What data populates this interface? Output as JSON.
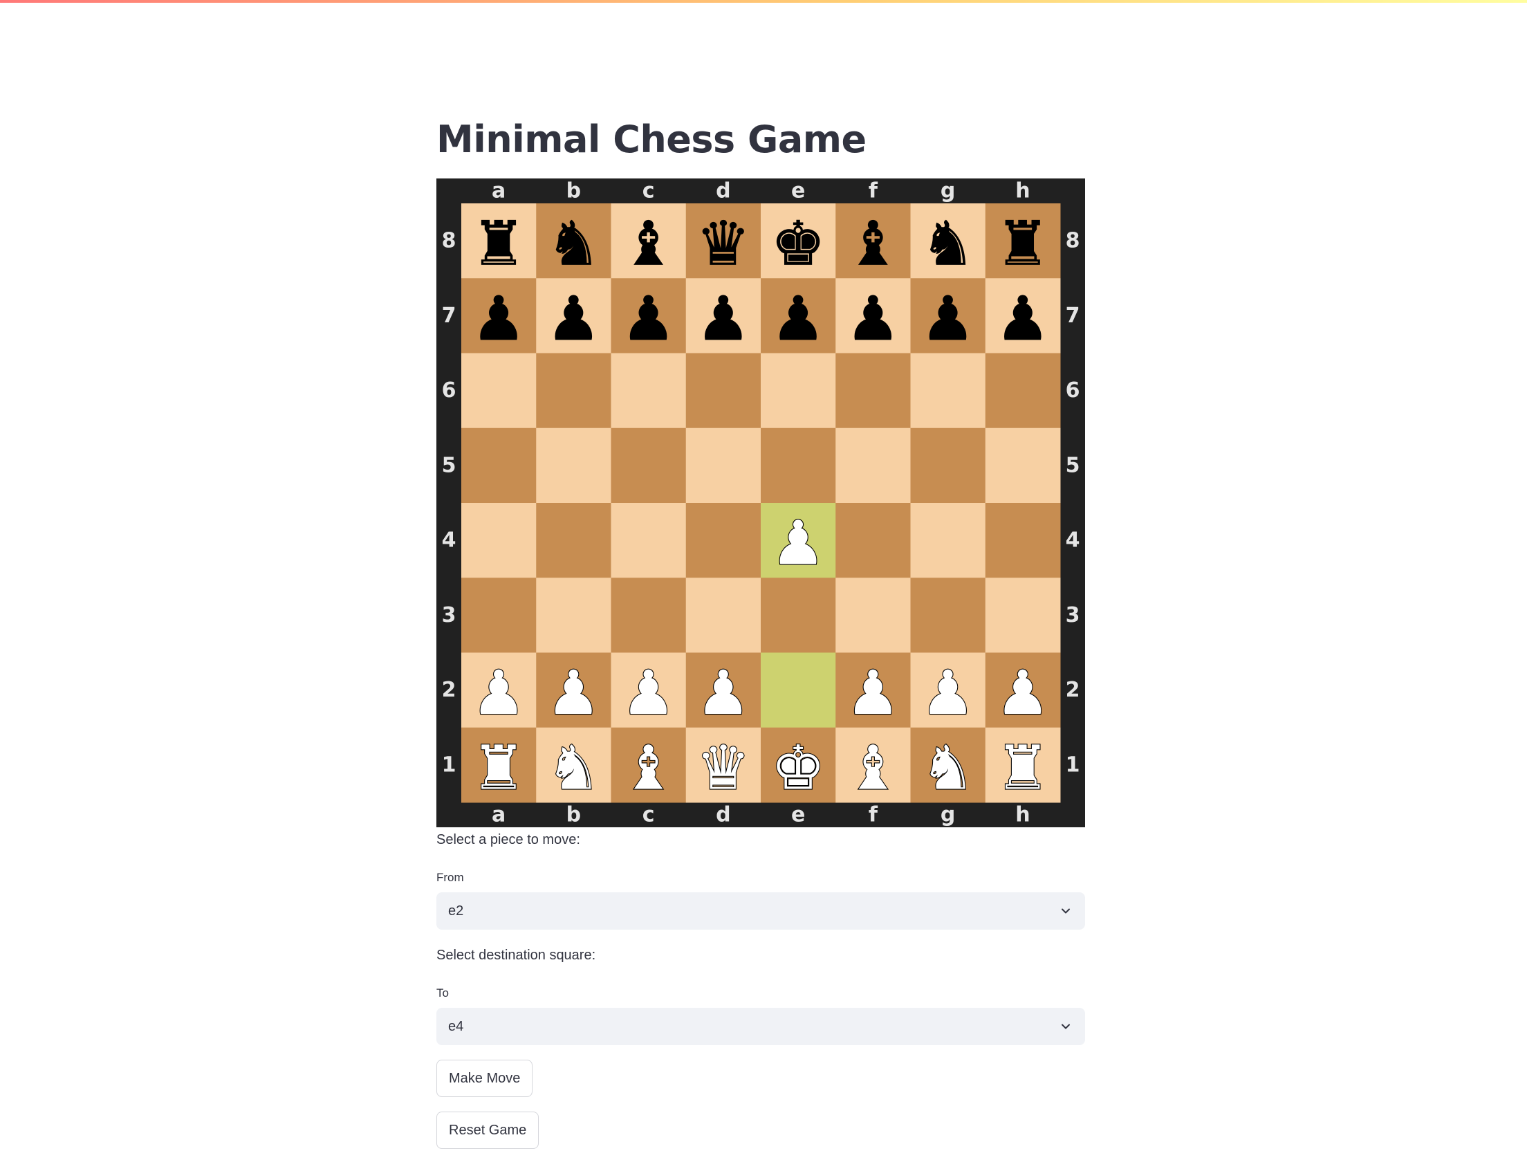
{
  "page": {
    "title": "Minimal Chess Game"
  },
  "board": {
    "files": [
      "a",
      "b",
      "c",
      "d",
      "e",
      "f",
      "g",
      "h"
    ],
    "ranks": [
      "8",
      "7",
      "6",
      "5",
      "4",
      "3",
      "2",
      "1"
    ],
    "colors": {
      "light": "#f7d0a3",
      "dark": "#c78d51",
      "highlight_light": "#cdd26f",
      "highlight_dark": "#aaa23a",
      "frame": "#212121",
      "coordinates": "#e5e5e5"
    },
    "highlighted_squares": [
      "e2",
      "e4"
    ],
    "position": [
      [
        "black-rook",
        "black-knight",
        "black-bishop",
        "black-queen",
        "black-king",
        "black-bishop",
        "black-knight",
        "black-rook"
      ],
      [
        "black-pawn",
        "black-pawn",
        "black-pawn",
        "black-pawn",
        "black-pawn",
        "black-pawn",
        "black-pawn",
        "black-pawn"
      ],
      [
        "",
        "",
        "",
        "",
        "",
        "",
        "",
        ""
      ],
      [
        "",
        "",
        "",
        "",
        "",
        "",
        "",
        ""
      ],
      [
        "",
        "",
        "",
        "",
        "white-pawn",
        "",
        "",
        ""
      ],
      [
        "",
        "",
        "",
        "",
        "",
        "",
        "",
        ""
      ],
      [
        "white-pawn",
        "white-pawn",
        "white-pawn",
        "white-pawn",
        "",
        "white-pawn",
        "white-pawn",
        "white-pawn"
      ],
      [
        "white-rook",
        "white-knight",
        "white-bishop",
        "white-queen",
        "white-king",
        "white-bishop",
        "white-knight",
        "white-rook"
      ]
    ]
  },
  "move_form": {
    "select_piece_caption": "Select a piece to move:",
    "from_label": "From",
    "from_value": "e2",
    "select_destination_caption": "Select destination square:",
    "to_label": "To",
    "to_value": "e4",
    "make_move_label": "Make Move",
    "reset_label": "Reset Game",
    "dropdown_icon": "chevron-down-icon"
  }
}
